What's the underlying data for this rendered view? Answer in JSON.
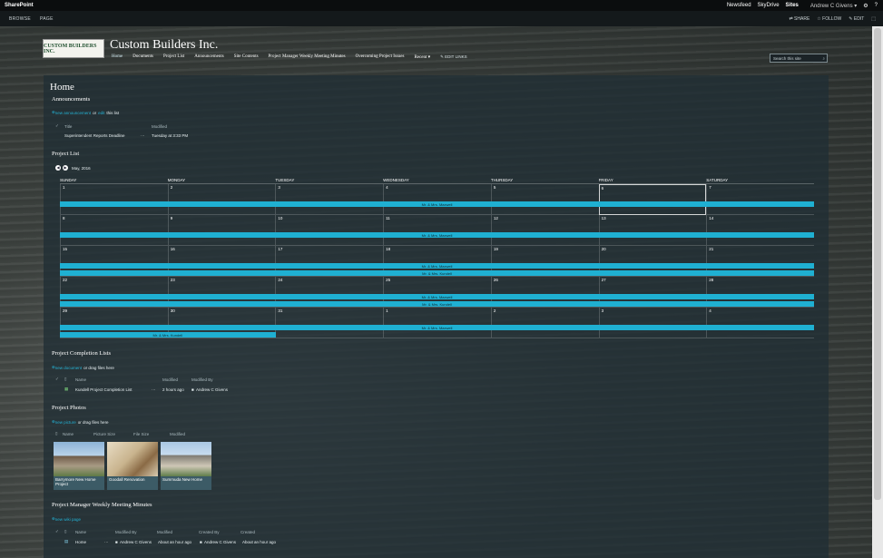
{
  "suite": {
    "brand": "SharePoint",
    "links": [
      "Newsfeed",
      "SkyDrive",
      "Sites"
    ],
    "active_link": "Sites",
    "user": "Andrew C Givens ▾",
    "settings_icon": "gear-icon",
    "help_icon": "question-icon"
  },
  "ribbon": {
    "tabs": [
      "BROWSE",
      "PAGE"
    ],
    "actions": [
      "SHARE",
      "FOLLOW",
      "EDIT"
    ]
  },
  "site": {
    "logo_text": "CUSTOM BUILDERS INC.",
    "title": "Custom Builders Inc.",
    "nav": [
      "Home",
      "Documents",
      "Project List",
      "Announcements",
      "Site Contents",
      "Project Manager Weekly Meeting Minutes",
      "Overcoming Project Issues",
      "Recent"
    ],
    "edit_links": "EDIT LINKS",
    "search_placeholder": "Search this site"
  },
  "page": {
    "title": "Home"
  },
  "announcements": {
    "title": "Announcements",
    "new_link": "new announcement",
    "or_text": "or",
    "edit_link": "edit",
    "this_list": "this list",
    "columns": [
      "Title",
      "Modified"
    ],
    "rows": [
      {
        "title": "Superintendent Reports Deadline",
        "modified": "Tuesday at 3:33 PM"
      }
    ]
  },
  "project_list": {
    "title": "Project List",
    "month": "May, 2016",
    "days": [
      "SUNDAY",
      "MONDAY",
      "TUESDAY",
      "WEDNESDAY",
      "THURSDAY",
      "FRIDAY",
      "SATURDAY"
    ],
    "weeks": [
      [
        "1",
        "2",
        "3",
        "4",
        "5",
        "6",
        "7"
      ],
      [
        "8",
        "9",
        "10",
        "11",
        "12",
        "13",
        "14"
      ],
      [
        "15",
        "16",
        "17",
        "18",
        "19",
        "20",
        "21"
      ],
      [
        "22",
        "23",
        "24",
        "25",
        "26",
        "27",
        "28"
      ],
      [
        "29",
        "30",
        "31",
        "1",
        "2",
        "3",
        "4"
      ]
    ],
    "events": [
      "Mr. & Mrs. Maxwell",
      "Mr. & Mrs. Maxwell",
      "Mr. & Mrs. Maxwell",
      "Mr. & Mrs. Kundell",
      "Mr. & Mrs. Maxwell",
      "Mr. & Mrs. Kundell",
      "Mr. & Mrs. Maxwell",
      "Mr. & Mrs. Kundell"
    ]
  },
  "completion": {
    "title": "Project Completion Lists",
    "new_link": "new document",
    "drag_text": "or drag files here",
    "columns": [
      "Name",
      "Modified",
      "Modified By"
    ],
    "rows": [
      {
        "name": "Kundell Project Completion List",
        "modified": "2 hours ago",
        "by": "Andrew C Givens"
      }
    ]
  },
  "photos": {
    "title": "Project Photos",
    "new_link": "new picture",
    "drag_text": "or drag files here",
    "columns": [
      "Name",
      "Picture Size",
      "File Size",
      "Modified"
    ],
    "items": [
      "Barrymore New Home Project",
      "Goodall Renovation",
      "Summuda New Home"
    ]
  },
  "minutes": {
    "title": "Project Manager Weekly Meeting Minutes",
    "new_link": "new wiki page",
    "columns": [
      "Name",
      "Modified By",
      "Modified",
      "Created By",
      "Created"
    ],
    "rows": [
      {
        "name": "Home",
        "modified_by": "Andrew C Givens",
        "modified": "About an hour ago",
        "created_by": "Andrew C Givens",
        "created": "About an hour ago"
      }
    ]
  }
}
